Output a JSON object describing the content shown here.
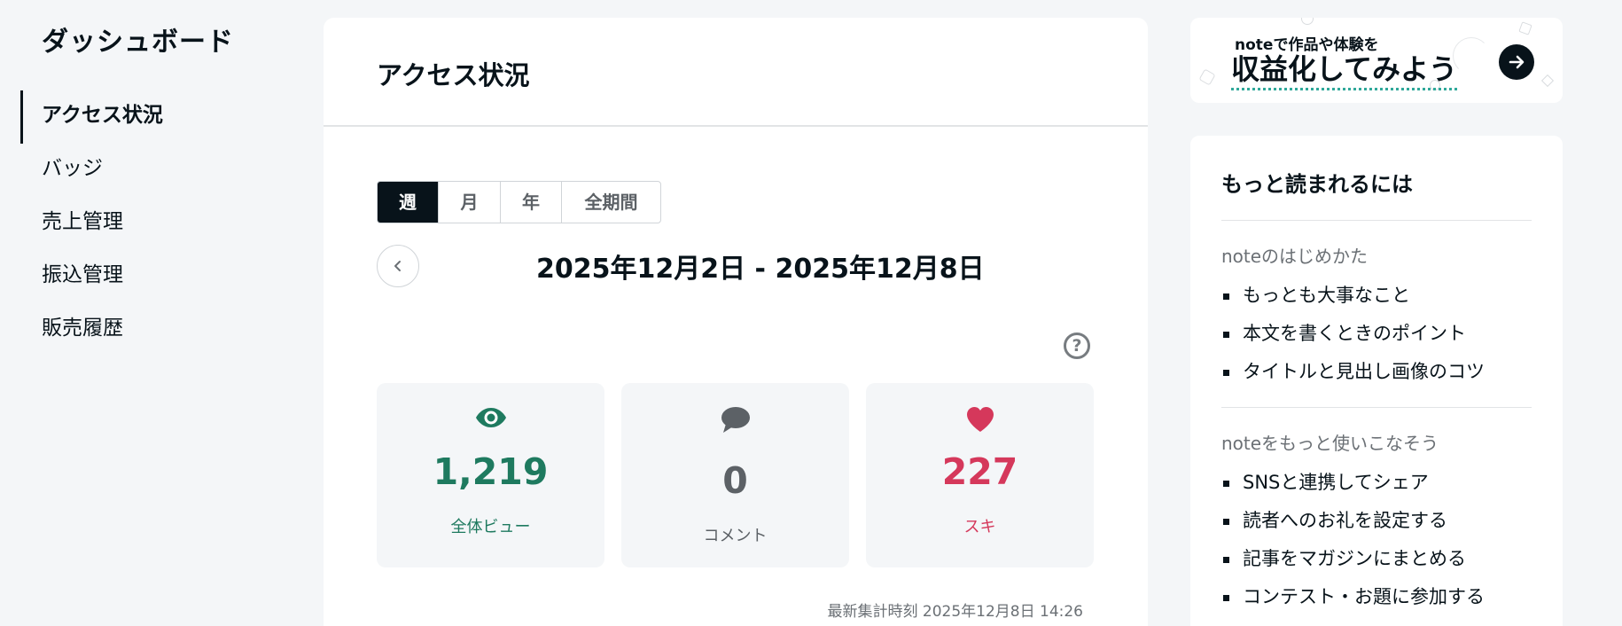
{
  "sidebar": {
    "title": "ダッシュボード",
    "items": [
      {
        "label": "アクセス状況"
      },
      {
        "label": "バッジ"
      },
      {
        "label": "売上管理"
      },
      {
        "label": "振込管理"
      },
      {
        "label": "販売履歴"
      }
    ],
    "active_item": "アクセス状況"
  },
  "main": {
    "title": "アクセス状況",
    "tabs": [
      {
        "label": "週"
      },
      {
        "label": "月"
      },
      {
        "label": "年"
      },
      {
        "label": "全期間"
      }
    ],
    "active_tab": "週",
    "date_range": "2025年12月2日  -  2025年12月8日",
    "help_icon": "question-circle-icon",
    "stats": [
      {
        "value": "1,219",
        "label": "全体ビュー",
        "icon": "eye-icon",
        "color": "#1e7a5f"
      },
      {
        "value": "0",
        "label": "コメント",
        "icon": "comment-icon",
        "color": "#5c6166"
      },
      {
        "value": "227",
        "label": "スキ",
        "icon": "heart-icon",
        "color": "#d5385b"
      }
    ],
    "updated_at": "最新集計時刻 2025年12月8日 14:26"
  },
  "banner": {
    "small_text": "noteで作品や体験を",
    "big_text": "収益化してみよう",
    "accent": "#2fa89a"
  },
  "tips": {
    "title": "もっと読まれるには",
    "groups": [
      {
        "title": "noteのはじめかた",
        "items": [
          "もっとも大事なこと",
          "本文を書くときのポイント",
          "タイトルと見出し画像のコツ"
        ]
      },
      {
        "title": "noteをもっと使いこなそう",
        "items": [
          "SNSと連携してシェア",
          "読者へのお礼を設定する",
          "記事をマガジンにまとめる",
          "コンテスト・お題に参加する"
        ]
      }
    ]
  }
}
